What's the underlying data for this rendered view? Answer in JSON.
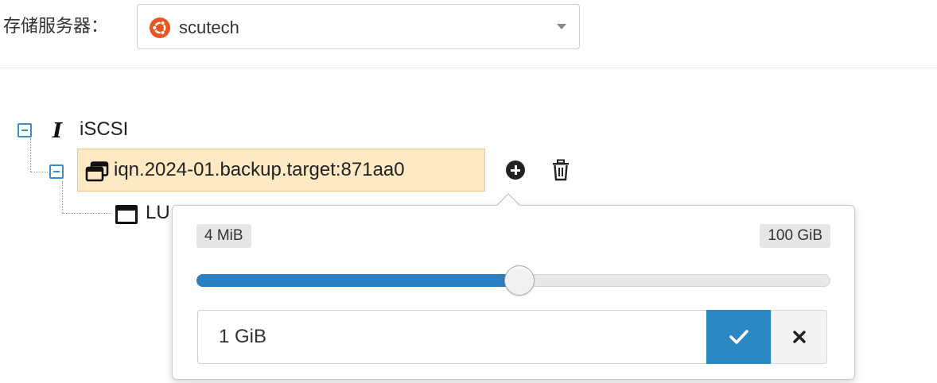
{
  "server": {
    "label": "存储服务器：",
    "selected": "scutech",
    "os_icon": "ubuntu-icon",
    "os_color": "#e95420"
  },
  "tree": {
    "root": {
      "label": "iSCSI",
      "icon": "i-beam-cursor-icon",
      "expanded": true
    },
    "target": {
      "label": "iqn.2024-01.backup.target:871aa0",
      "icon": "windows-stack-icon",
      "expanded": true,
      "selected": true,
      "highlight_color": "#fde9c4"
    },
    "lun": {
      "label": "LU",
      "icon": "window-icon"
    },
    "actions": {
      "add_icon": "plus-circle-icon",
      "delete_icon": "trash-icon"
    }
  },
  "size_popover": {
    "min_label": "4 MiB",
    "max_label": "100 GiB",
    "slider_fraction": 0.51,
    "input_value": "1 GiB",
    "confirm_icon": "check-icon",
    "cancel_icon": "close-icon",
    "accent_color": "#2b7fc0"
  }
}
